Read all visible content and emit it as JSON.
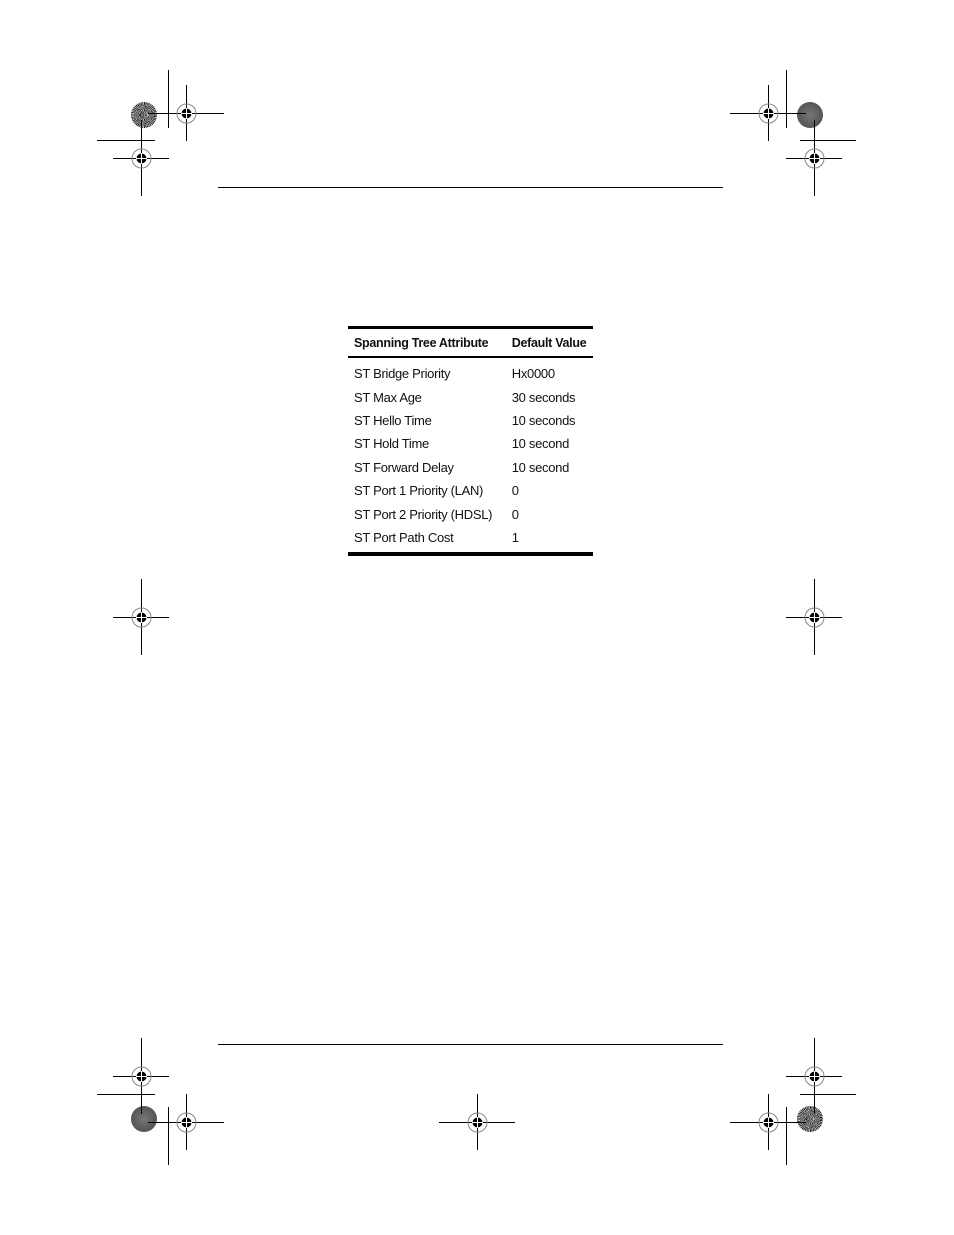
{
  "table": {
    "headers": [
      "Spanning Tree Attribute",
      "Default Value"
    ],
    "rows": [
      {
        "attribute": "ST Bridge Priority",
        "value": "Hx0000"
      },
      {
        "attribute": "ST Max Age",
        "value": "30 seconds"
      },
      {
        "attribute": "ST Hello Time",
        "value": "10 seconds"
      },
      {
        "attribute": "ST Hold Time",
        "value": "10 second"
      },
      {
        "attribute": "ST Forward Delay",
        "value": "10 second"
      },
      {
        "attribute": "ST Port 1 Priority (LAN)",
        "value": "0"
      },
      {
        "attribute": "ST Port 2 Priority (HDSL)",
        "value": "0"
      },
      {
        "attribute": "ST Port Path Cost",
        "value": "1"
      }
    ]
  },
  "registration_marks": {
    "icon": "crosshair-registration-icon",
    "star_icon": "color-star-target-icon"
  }
}
